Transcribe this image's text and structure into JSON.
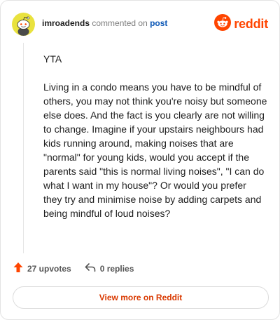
{
  "colors": {
    "brand": "#ff4500",
    "link": "#0a56b5",
    "button_text": "#d93900",
    "avatar_bg": "#e9e23e"
  },
  "header": {
    "username": "imroadends",
    "commented_text": "commented on",
    "post_link": "post",
    "brand_name": "reddit",
    "avatar_icon": "snoo-avatar-icon",
    "logo_icon": "reddit-snoo-icon"
  },
  "comment": {
    "paragraphs": [
      "YTA",
      "Living in a condo means you have to be mindful of others, you may not think you're noisy but someone else does. And the fact is you clearly are not willing to change. Imagine if your upstairs neighbours had kids running around, making noises that are \"normal\" for young kids, would you accept if the parents said \"this is normal living noises\", \"I can do what I want in my house\"? Or would you prefer they try and minimise noise by adding carpets and being mindful of loud noises?"
    ]
  },
  "actions": {
    "upvotes": "27 upvotes",
    "replies": "0 replies",
    "upvote_icon": "upvote-arrow-icon",
    "reply_icon": "reply-arrow-icon"
  },
  "footer": {
    "view_button": "View more on Reddit"
  }
}
